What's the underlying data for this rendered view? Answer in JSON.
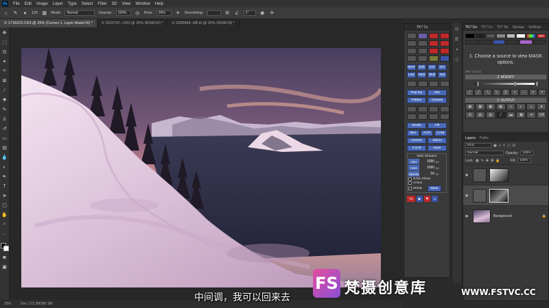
{
  "app": {
    "logo": "Ps"
  },
  "menu": [
    "File",
    "Edit",
    "Image",
    "Layer",
    "Type",
    "Select",
    "Filter",
    "3D",
    "View",
    "Window",
    "Help"
  ],
  "options": {
    "mode_label": "Mode:",
    "mode_value": "Normal",
    "opacity_label": "Opacity:",
    "opacity_value": "100%",
    "flow_label": "Flow:",
    "flow_value": "20%",
    "smoothing_label": "Smoothing:",
    "angle_value": "1°",
    "brush_size": "125"
  },
  "doc_tabs": [
    {
      "label": "© 1718223.CR3 @ 25% (Curves 1, Layer Mask/16) *",
      "active": true
    },
    {
      "label": "© 2523797-.CR3 @ 25% (RGB/16) *",
      "active": false
    },
    {
      "label": "© 2289884-.tif8.tif @ 25% (RGB/16) *",
      "active": false
    }
  ],
  "status": {
    "zoom": "25%",
    "doc": "Doc: 172.3M/387.3M"
  },
  "subtitle": "中间调，我可以回来去",
  "tkcx": {
    "title": "TK7 Cx",
    "rows": [
      [
        "Norm",
        "Soft",
        "Col",
        "Scr"
      ],
      [
        "Lum",
        "Hard",
        "Mult",
        "Sat"
      ]
    ],
    "pairs": [
      [
        "Dup lay",
        "Sav"
      ],
      [
        "Flatten",
        "Canvas"
      ],
      [
        "Stroke",
        "Fill"
      ],
      [
        "Blur",
        "ACR",
        "CAM"
      ],
      [
        "Inverse",
        "Select"
      ],
      [
        "S & M",
        "Save"
      ]
    ],
    "web": {
      "title": "Web Sharpen",
      "vert_label": "Vert",
      "vert_value": "1080",
      "vert_unit": "px",
      "horz_label": "Horz",
      "horz_value": "1080",
      "horz_unit": "px",
      "opacity_label": "Opacity",
      "opacity_value": "50",
      "opacity_unit": "%",
      "extra": "Extra Sharp",
      "action": "Action",
      "srgb": "sRGB",
      "save": "Save"
    },
    "footer": "TK"
  },
  "tkgo": {
    "tabs": [
      "TK7 Go",
      "TK7 Cx",
      "TK7 Ba",
      "Storage",
      "Settings"
    ],
    "swatch_text": "S/V",
    "message": "1. Choose a source to view MASK options.",
    "version": "TK7 v 2.0.1",
    "modify": "2. MODIFY",
    "output": "3. OUTPUT",
    "lm": "LM"
  },
  "layers_panel": {
    "tabs": [
      "Layers",
      "Paths"
    ],
    "kind": "Kind",
    "blend": "Normal",
    "opacity_label": "Opacity:",
    "opacity_value": "100%",
    "lock_label": "Lock:",
    "fill_label": "Fill:",
    "fill_value": "100%",
    "background_name": "Background"
  },
  "watermark": {
    "logo": "FS",
    "text": "梵摄创意库",
    "url": "WWW.FSTVC.CC"
  },
  "colors": {
    "accent": "#4a6ab8",
    "panel": "#3b3b3b",
    "sky_top": "#4b4262",
    "sky_glow": "#e09aa0"
  }
}
